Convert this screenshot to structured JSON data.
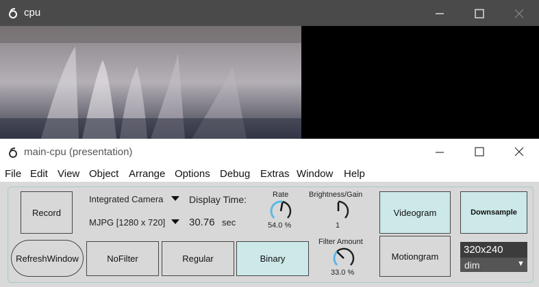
{
  "top_window": {
    "title": "cpu"
  },
  "main_window": {
    "title": "main-cpu (presentation)"
  },
  "menu": [
    "File",
    "Edit",
    "View",
    "Object",
    "Arrange",
    "Options",
    "Debug",
    "Extras",
    "Window",
    "Help"
  ],
  "controls": {
    "record": "Record",
    "refresh": "RefreshWindow",
    "nofilter": "NoFilter",
    "regular": "Regular",
    "binary": "Binary",
    "camera": "Integrated Camera",
    "format": "MJPG [1280 x 720]",
    "display_time_label": "Display Time:",
    "display_time_value": "30.76",
    "display_time_unit": "sec",
    "rate_label": "Rate",
    "rate_value": "54.0 %",
    "brightness_label": "Brightness/Gain",
    "brightness_value": "1",
    "filter_label": "Filter Amount",
    "filter_value": "33.0 %",
    "videogram": "Videogram",
    "motiongram": "Motiongram",
    "downsample": "Downsample",
    "resolution": "320x240",
    "dim_option": "dim"
  },
  "dials": {
    "rate_fraction": 0.54,
    "brightness_fraction": 0.5,
    "filter_fraction": 0.33
  },
  "colors": {
    "toggle_on": "#cce8e8",
    "panel_border": "#a8c8cc",
    "dial_arc": "#5bb8e6"
  }
}
